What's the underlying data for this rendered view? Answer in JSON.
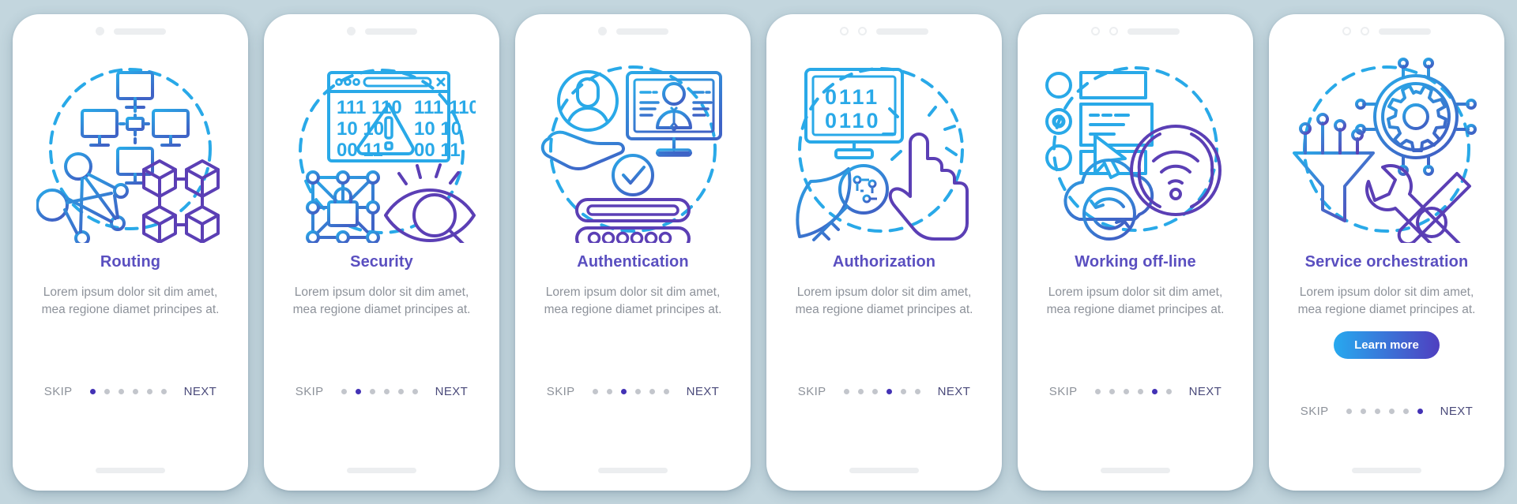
{
  "theme": {
    "background": "#c3d6de",
    "card_background": "#ffffff",
    "title_color": "#5a4fc0",
    "body_color": "#8d929a",
    "dot_active_color": "#4332b5",
    "dot_inactive_color": "#c3c6cc",
    "next_color": "#4a4a7a",
    "cta_gradient_from": "#27a9ef",
    "cta_gradient_to": "#4f3fc0",
    "icon_gradient_from": "#29a9e8",
    "icon_gradient_to": "#5b3fb5"
  },
  "nav": {
    "skip_label": "SKIP",
    "next_label": "NEXT",
    "total_dots": 6
  },
  "screens": [
    {
      "id": "routing",
      "title": "Routing",
      "body": "Lorem ipsum dolor sit dim amet, mea regione diamet principes at.",
      "active_dot": 1,
      "status_style": "dot-and-speaker",
      "cta": null,
      "illustration": "routing-illustration",
      "illustration_parts": [
        "dashed-circle",
        "monitor-network",
        "node-graph",
        "cube-chain"
      ]
    },
    {
      "id": "security",
      "title": "Security",
      "body": "Lorem ipsum dolor sit dim amet, mea regione diamet principes at.",
      "active_dot": 2,
      "status_style": "dot-and-speaker",
      "cta": null,
      "illustration": "security-illustration",
      "illustration_parts": [
        "browser-window",
        "binary-digits",
        "warning-triangle",
        "lock-network",
        "eye-magnifier"
      ],
      "binary_rows": [
        "111  110",
        "10   10",
        "00   11"
      ]
    },
    {
      "id": "authentication",
      "title": "Authentication",
      "body": "Lorem ipsum dolor sit dim amet, mea regione diamet principes at.",
      "active_dot": 3,
      "status_style": "dot-and-speaker",
      "cta": null,
      "illustration": "authentication-illustration",
      "illustration_parts": [
        "hand-holding-avatar",
        "monitor-profile",
        "check-circle",
        "login-field",
        "password-field"
      ]
    },
    {
      "id": "authorization",
      "title": "Authorization",
      "body": "Lorem ipsum dolor sit dim amet, mea regione diamet principes at.",
      "active_dot": 4,
      "status_style": "two-rings-and-speaker",
      "cta": null,
      "illustration": "authorization-illustration",
      "illustration_parts": [
        "monitor-binary",
        "shield-key",
        "pointing-hand"
      ],
      "binary_rows": [
        "0111",
        "0110"
      ]
    },
    {
      "id": "working-offline",
      "title": "Working off-line",
      "body": "Lorem ipsum dolor sit dim amet, mea regione diamet principes at.",
      "active_dot": 5,
      "status_style": "two-rings-and-speaker",
      "cta": null,
      "illustration": "working-offline-illustration",
      "illustration_parts": [
        "radio-buttons",
        "form-rows",
        "cursor-arrow",
        "cloud-sync",
        "wifi-off-circle"
      ]
    },
    {
      "id": "service-orchestration",
      "title": "Service orchestration",
      "body": "Lorem ipsum dolor sit dim amet, mea regione diamet principes at.",
      "active_dot": 6,
      "status_style": "two-rings-and-speaker",
      "cta": "Learn more",
      "illustration": "service-orchestration-illustration",
      "illustration_parts": [
        "funnel-connectors",
        "gear-circuit",
        "wrench-screwdriver"
      ]
    }
  ]
}
